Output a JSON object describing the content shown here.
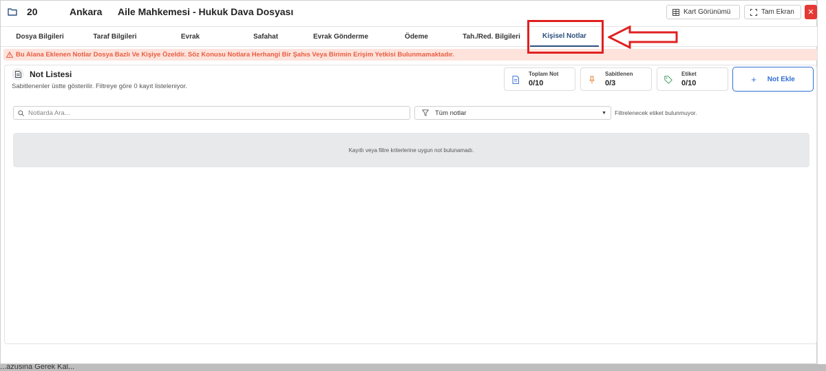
{
  "header": {
    "case_number": "20",
    "city": "Ankara",
    "court_title": "Aile Mahkemesi - Hukuk Dava Dosyası",
    "card_view_label": "Kart Görünümü",
    "fullscreen_label": "Tam Ekran",
    "close_label": "✕"
  },
  "tabs": [
    {
      "label": "Dosya Bilgileri"
    },
    {
      "label": "Taraf Bilgileri"
    },
    {
      "label": "Evrak"
    },
    {
      "label": "Safahat"
    },
    {
      "label": "Evrak Gönderme"
    },
    {
      "label": "Ödeme"
    },
    {
      "label": "Tah./Red. Bilgileri"
    },
    {
      "label": "Kişisel Notlar",
      "active": true
    }
  ],
  "alert": {
    "text": "Bu Alana Eklenen Notlar Dosya Bazlı Ve Kişiye Özeldir. Söz Konusu Notlara Herhangi Bir Şahıs Veya Birimin Erişim Yetkisi Bulunmamaktadır."
  },
  "notes": {
    "title": "Not Listesi",
    "subtitle": "Sabitlenenler üstte gösterilir. Filtreye göre 0 kayıt listeleniyor.",
    "stats": [
      {
        "label": "Toplam Not",
        "value": "0/10",
        "icon": "document-icon",
        "color": "#3b6fd8"
      },
      {
        "label": "Sabitlenen",
        "value": "0/3",
        "icon": "pin-icon",
        "color": "#e8833a"
      },
      {
        "label": "Etiket",
        "value": "0/10",
        "icon": "tag-icon",
        "color": "#3a9d5a"
      }
    ],
    "add_label": "Not Ekle",
    "search_placeholder": "Notlarda Ara...",
    "filter_value": "Tüm notlar",
    "filter_note": "Filtrelenecek etiket bulunmuyor.",
    "empty_message": "Kayıtlı veya filtre kriterlerine uygun not bulunamadı."
  },
  "background": {
    "partial_text": "...azusina Gerek Kal..."
  },
  "colors": {
    "accent": "#2a4f7d",
    "primary": "#2f6fd6",
    "alert_bg": "#fde3dc",
    "alert_text": "#e85d40",
    "annotation_red": "#e02020",
    "close_red": "#e53935"
  }
}
